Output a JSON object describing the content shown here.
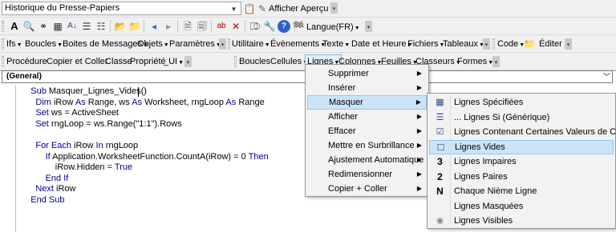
{
  "toolbar1": {
    "clipboard_combo": "Historique du Presse-Papiers",
    "afficher_apercu": "Afficher Aperçu"
  },
  "toolbar2": {
    "langue": "Langue(FR)"
  },
  "toolbar3": {
    "items": [
      "Ifs",
      "Boucles",
      "Boites de Messages",
      "Objets",
      "Paramètres",
      "Utilitaire",
      "Évènements",
      "Texte",
      "Date et Heure",
      "Fichiers",
      "Tableaux",
      "Code",
      "Éditer"
    ]
  },
  "toolbar4": {
    "left_items": [
      "Procédure",
      "Copier et Coller",
      "Classe",
      "Propriété",
      "_UI"
    ],
    "right_items": [
      "Boucles",
      "Cellules",
      "Lignes",
      "Colonnes",
      "Feuilles",
      "Classeurs",
      "Formes"
    ]
  },
  "editor": {
    "object_combo": "(General)",
    "code": [
      [
        [
          "",
          "    "
        ],
        [
          "kw",
          "Sub"
        ],
        [
          "",
          " Masquer_Lignes_Vides()"
        ]
      ],
      [
        [
          "",
          "      "
        ],
        [
          "kw",
          "Dim"
        ],
        [
          "",
          " iRow "
        ],
        [
          "kw",
          "As"
        ],
        [
          "",
          " Range, ws "
        ],
        [
          "kw",
          "As"
        ],
        [
          "",
          " Worksheet, rngLoop "
        ],
        [
          "kw",
          "As"
        ],
        [
          "",
          " Range"
        ]
      ],
      [
        [
          "",
          "      "
        ],
        [
          "kw",
          "Set"
        ],
        [
          "",
          " ws = ActiveSheet"
        ]
      ],
      [
        [
          "",
          "      "
        ],
        [
          "kw",
          "Set"
        ],
        [
          "",
          " rngLoop = ws.Range(\"1:1\").Rows"
        ]
      ],
      [
        [
          "",
          ""
        ]
      ],
      [
        [
          "",
          "      "
        ],
        [
          "kw",
          "For Each"
        ],
        [
          "",
          " iRow "
        ],
        [
          "kw",
          "In"
        ],
        [
          "",
          " rngLoop"
        ]
      ],
      [
        [
          "",
          "          "
        ],
        [
          "kw",
          "If"
        ],
        [
          "",
          " Application.WorksheetFunction.CountA(iRow) = 0 "
        ],
        [
          "kw",
          "Then"
        ]
      ],
      [
        [
          "",
          "              iRow.Hidden = "
        ],
        [
          "kw",
          "True"
        ]
      ],
      [
        [
          "",
          "          "
        ],
        [
          "kw",
          "End If"
        ]
      ],
      [
        [
          "",
          "      "
        ],
        [
          "kw",
          "Next"
        ],
        [
          "",
          " iRow"
        ]
      ],
      [
        [
          "",
          "    "
        ],
        [
          "kw",
          "End Sub"
        ]
      ]
    ]
  },
  "menu1": {
    "items": [
      "Supprimer",
      "Insérer",
      "Masquer",
      "Afficher",
      "Effacer",
      "Mettre en Surbrillance",
      "Ajustement Automatique",
      "Redimensionner",
      "Copier + Coller"
    ],
    "highlighted": "Masquer"
  },
  "menu2": {
    "items": [
      {
        "label": "Lignes Spécifiées",
        "icon": "grid-icon"
      },
      {
        "label": "... Lignes Si (Générique)",
        "icon": "list-icon"
      },
      {
        "label": "Lignes Contenant Certaines Valeurs de Cellule",
        "icon": "checkbox-icon"
      },
      {
        "label": "Lignes Vides",
        "icon": "empty-box-icon"
      },
      {
        "label": "Lignes Impaires",
        "icon": "number-3-icon",
        "glyph": "3"
      },
      {
        "label": "Lignes Paires",
        "icon": "number-2-icon",
        "glyph": "2"
      },
      {
        "label": "Chaque Nième Ligne",
        "icon": "letter-n-icon",
        "glyph": "N"
      },
      {
        "label": "Lignes Masquées",
        "icon": "none"
      },
      {
        "label": "Lignes Visibles",
        "icon": "eye-icon"
      }
    ],
    "highlighted": "Lignes Vides"
  },
  "colors": {
    "keyword": "#00008b",
    "highlight": "#cce4f7",
    "highlight_border": "#90c8f6"
  }
}
